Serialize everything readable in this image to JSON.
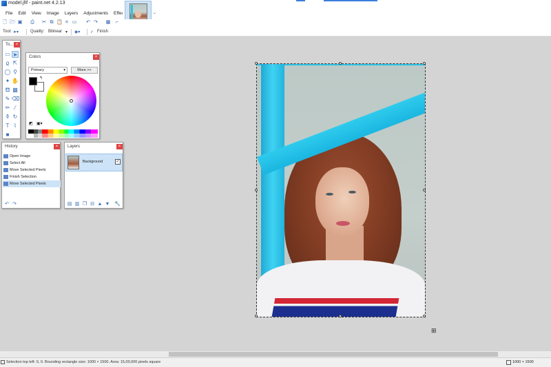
{
  "window": {
    "title": "model.jfif - paint.net 4.2.13"
  },
  "menu": {
    "items": [
      "File",
      "Edit",
      "View",
      "Image",
      "Layers",
      "Adjustments",
      "Effects"
    ]
  },
  "tool_options": {
    "tool_label": "Tool:",
    "quality_label": "Quality:",
    "quality_value": "Bilinear",
    "finish_label": "Finish"
  },
  "tools_window": {
    "title": "To..."
  },
  "colors_window": {
    "title": "Colors",
    "mode_select": "Primary",
    "more_button": "More >>",
    "primary_color": "#000000",
    "secondary_color": "#ffffff"
  },
  "history_window": {
    "title": "History",
    "items": [
      {
        "label": "Open Image",
        "selected": false
      },
      {
        "label": "Select All",
        "selected": false
      },
      {
        "label": "Move Selected Pixels",
        "selected": false
      },
      {
        "label": "Finish Selection",
        "selected": false
      },
      {
        "label": "Move Selected Pixels",
        "selected": true
      }
    ]
  },
  "layers_window": {
    "title": "Layers",
    "layers": [
      {
        "name": "Background",
        "visible": true
      }
    ]
  },
  "status": {
    "selection_info": "Selection top left: 0, 0. Bounding rectangle size: 1000 × 1500. Area: 15,00,000 pixels square",
    "image_size": "1000 × 1500"
  },
  "colors": {
    "accent": "#3b7ddd",
    "selection_highlight": "#cde3f7",
    "close_button": "#e04343"
  }
}
